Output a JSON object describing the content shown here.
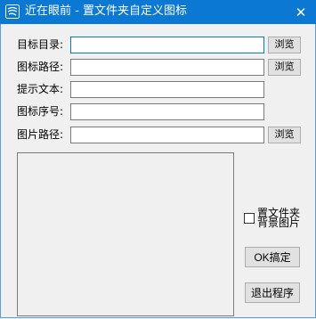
{
  "window": {
    "title": "近在眼前 - 置文件夹自定义图标",
    "close_label": "✕"
  },
  "form": {
    "target_dir": {
      "label": "目标目录:",
      "value": "",
      "browse_label": "浏览"
    },
    "icon_path": {
      "label": "图标路径:",
      "value": "",
      "browse_label": "浏览"
    },
    "tooltip_text": {
      "label": "提示文本:",
      "value": ""
    },
    "icon_index": {
      "label": "图标序号:",
      "value": ""
    },
    "image_path": {
      "label": "图片路径:",
      "value": "",
      "browse_label": "浏览"
    }
  },
  "options": {
    "set_background": {
      "label": "置文件夹背景图片",
      "checked": false
    }
  },
  "buttons": {
    "ok_label": "OK搞定",
    "exit_label": "退出程序"
  }
}
